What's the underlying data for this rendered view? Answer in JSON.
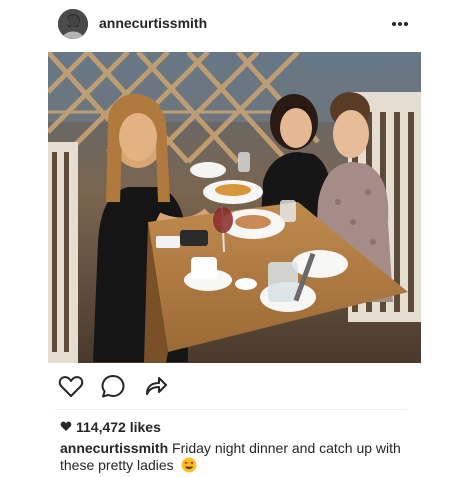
{
  "post": {
    "username": "annecurtissmith",
    "more_icon": "more-horizontal-icon",
    "likes_icon": "heart-small-icon",
    "likes_text": "114,472 likes",
    "caption_user": "annecurtissmith",
    "caption_text": "Friday night dinner and catch up with these pretty ladies",
    "caption_emoji": "heart-eyes-emoji"
  },
  "actions": {
    "like_icon": "heart-outline-icon",
    "comment_icon": "comment-icon",
    "share_icon": "share-icon"
  }
}
